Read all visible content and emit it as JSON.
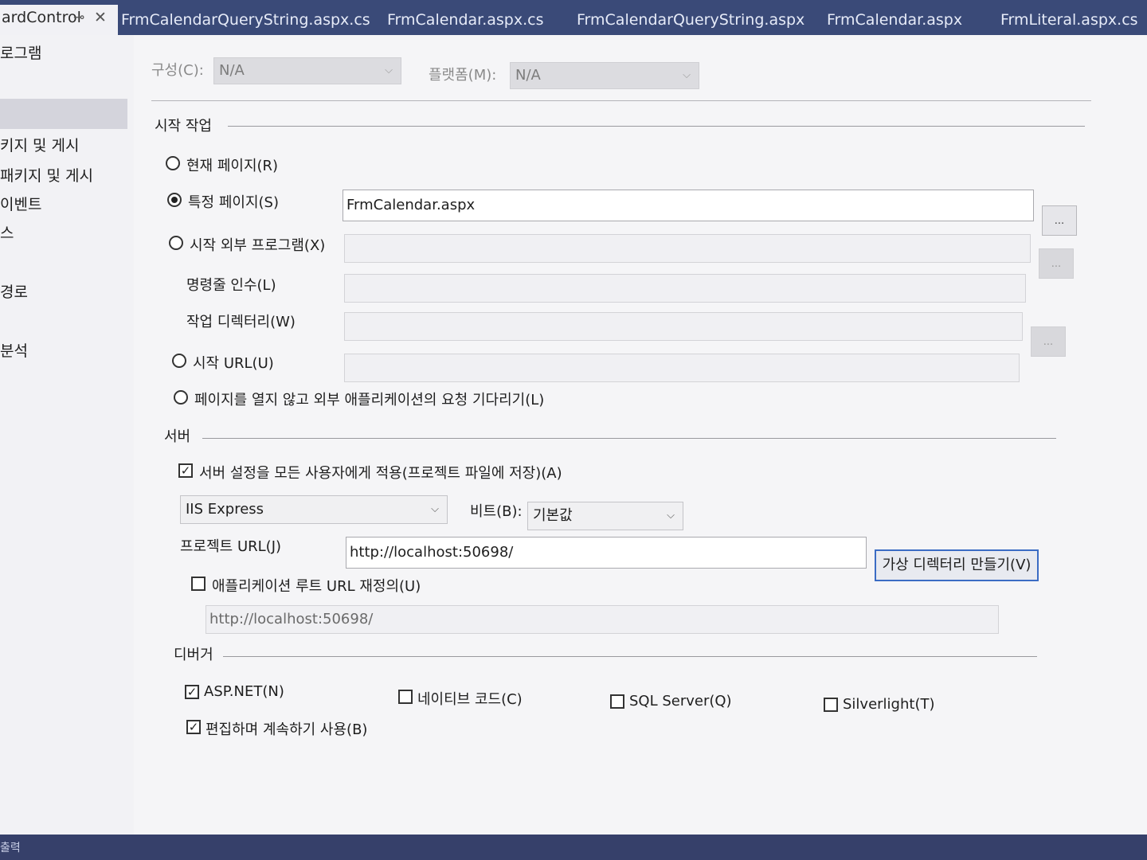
{
  "tabs": {
    "first": {
      "label": "ardControl",
      "pin_icon": "pin-icon",
      "close_icon": "close-icon"
    },
    "items": [
      {
        "label": "FrmCalendarQueryString.aspx.cs"
      },
      {
        "label": "FrmCalendar.aspx.cs"
      },
      {
        "label": "FrmCalendarQueryString.aspx"
      },
      {
        "label": "FrmCalendar.aspx"
      },
      {
        "label": "FrmLiteral.aspx.cs"
      }
    ]
  },
  "sidebar": {
    "items": [
      {
        "label": "로그램"
      },
      {
        "label": ""
      },
      {
        "label": "키지 및 게시"
      },
      {
        "label": "패키지 및 게시"
      },
      {
        "label": "이벤트"
      },
      {
        "label": "스"
      },
      {
        "label": "경로"
      },
      {
        "label": "분석"
      }
    ]
  },
  "config": {
    "config_label": "구성(C):",
    "config_value": "N/A",
    "platform_label": "플랫폼(M):",
    "platform_value": "N/A"
  },
  "start_action": {
    "section_title": "시작 작업",
    "current_page": "현재 페이지(R)",
    "specific_page": "특정 페이지(S)",
    "specific_page_value": "FrmCalendar.aspx",
    "external_program": "시작 외부 프로그램(X)",
    "command_args": "명령줄 인수(L)",
    "working_dir": "작업 디렉터리(W)",
    "start_url": "시작 URL(U)",
    "wait_request": "페이지를 열지 않고 외부 애플리케이션의 요청 기다리기(L)",
    "browse_label": "..."
  },
  "server": {
    "section_title": "서버",
    "apply_all": "서버 설정을 모든 사용자에게 적용(프로젝트 파일에 저장)(A)",
    "server_type": "IIS Express",
    "bitness_label": "비트(B):",
    "bitness_value": "기본값",
    "project_url_label": "프로젝트 URL(J)",
    "project_url_value": "http://localhost:50698/",
    "create_vdir": "가상 디렉터리 만들기(V)",
    "override_root": "애플리케이션 루트 URL 재정의(U)",
    "override_root_value": "http://localhost:50698/"
  },
  "debugger": {
    "section_title": "디버거",
    "aspnet": "ASP.NET(N)",
    "native": "네이티브 코드(C)",
    "sql": "SQL Server(Q)",
    "silverlight": "Silverlight(T)",
    "edit_continue": "편집하며 계속하기 사용(B)"
  },
  "bottom": {
    "output_label": "출력"
  },
  "colors": {
    "tabbar": "#3a4a78",
    "accent_button_border": "#3b6cc4"
  }
}
